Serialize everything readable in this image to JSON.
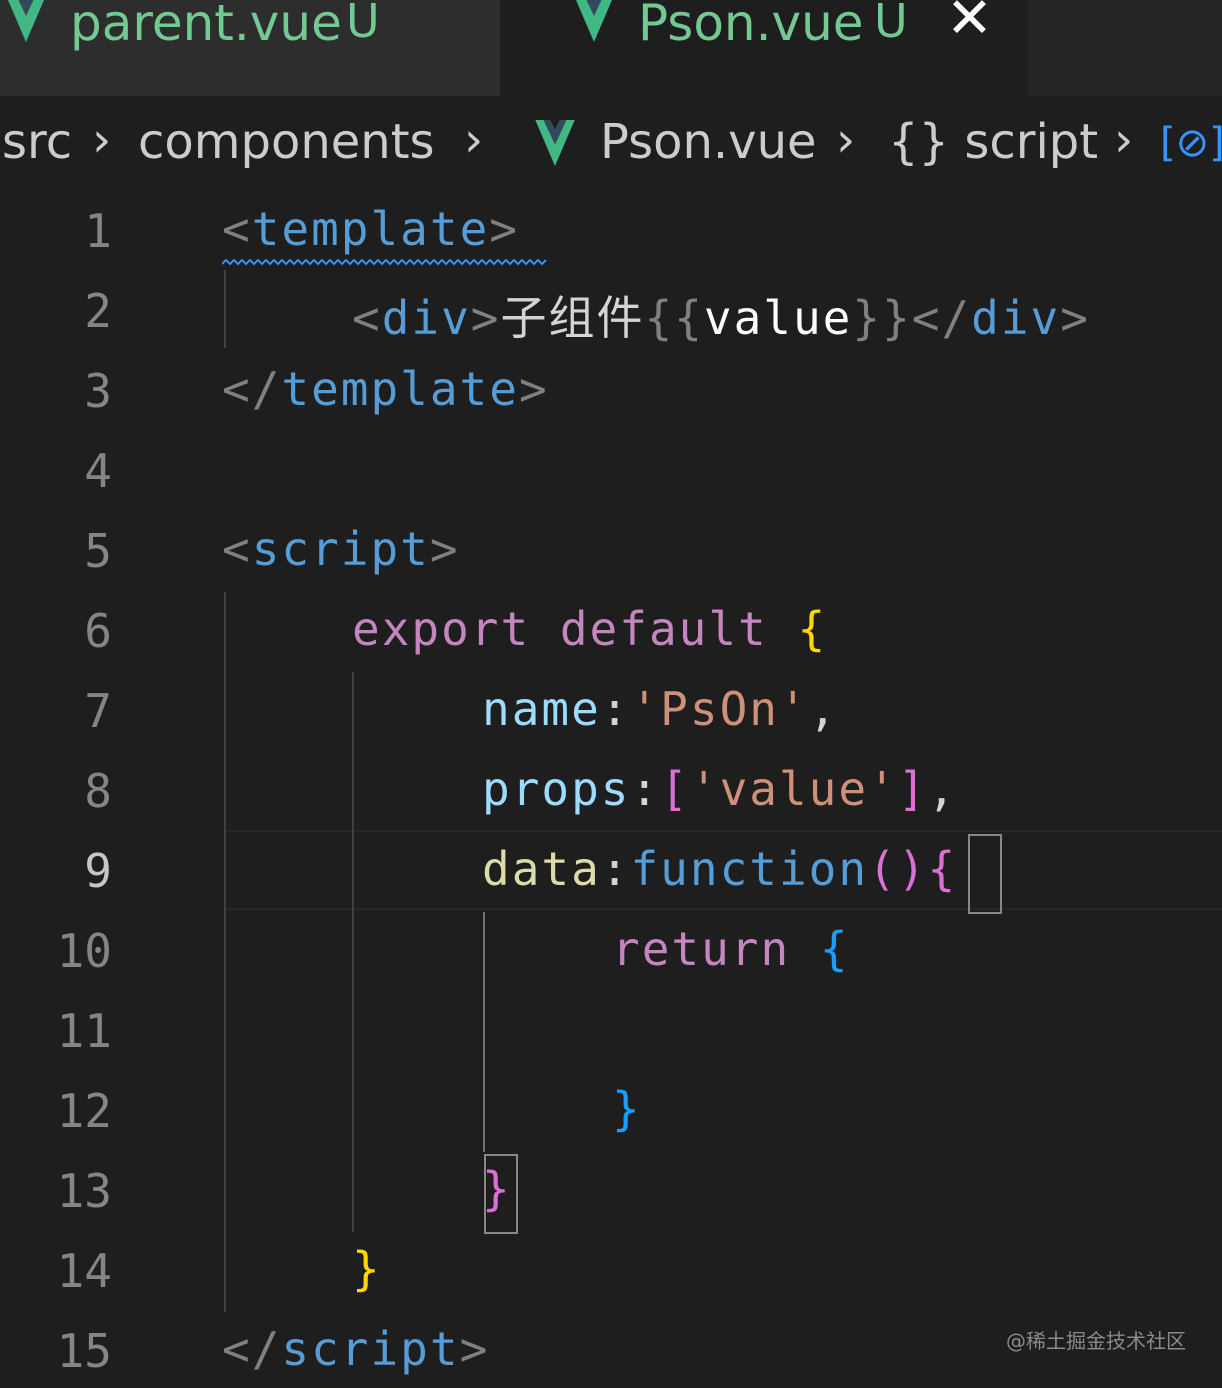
{
  "tabs": [
    {
      "name": "parent.vue",
      "badge": "U",
      "active": false
    },
    {
      "name": "Pson.vue",
      "badge": "U",
      "active": true,
      "close": "✕"
    }
  ],
  "breadcrumb": {
    "items": [
      "src",
      "components",
      "Pson.vue",
      "{} script"
    ],
    "separator": "›",
    "trailing_icon": "[⊘]"
  },
  "editor": {
    "current_line": 9,
    "line_numbers": [
      "1",
      "2",
      "3",
      "4",
      "5",
      "6",
      "7",
      "8",
      "9",
      "10",
      "11",
      "12",
      "13",
      "14",
      "15"
    ],
    "lines": {
      "l1": {
        "open": "<",
        "tag": "template",
        "close": ">"
      },
      "l2": {
        "open": "<",
        "tag": "div",
        "close": ">",
        "text": "子组件",
        "mustache_open": "{{",
        "expr": "value",
        "mustache_close": "}}",
        "end_open": "</",
        "end_tag": "div",
        "end_close": ">"
      },
      "l3": {
        "open": "</",
        "tag": "template",
        "close": ">"
      },
      "l5": {
        "open": "<",
        "tag": "script",
        "close": ">"
      },
      "l6": {
        "kw": "export default",
        "brace": "{"
      },
      "l7": {
        "key": "name",
        "colon": ":",
        "value": "'PsOn'",
        "comma": ","
      },
      "l8": {
        "key": "props",
        "colon": ":",
        "bracket_open": "[",
        "value": "'value'",
        "bracket_close": "]",
        "comma": ","
      },
      "l9": {
        "key": "data",
        "colon": ":",
        "fn": "function",
        "paren": "()",
        "brace": "{"
      },
      "l10": {
        "kw": "return",
        "brace": "{"
      },
      "l12": {
        "brace": "}"
      },
      "l13": {
        "brace": "}"
      },
      "l14": {
        "brace": "}"
      },
      "l15": {
        "open": "</",
        "tag": "script",
        "close": ">"
      }
    }
  },
  "colors": {
    "background": "#1e1e1e",
    "tab_modified": "#73c991",
    "tag": "#569cd6",
    "keyword": "#c586c0",
    "string": "#ce9178",
    "property": "#9cdcfe",
    "bracket_gold": "#ffd700",
    "bracket_purple": "#da70d6",
    "bracket_blue": "#179fff"
  },
  "watermark": "@稀土掘金技术社区"
}
